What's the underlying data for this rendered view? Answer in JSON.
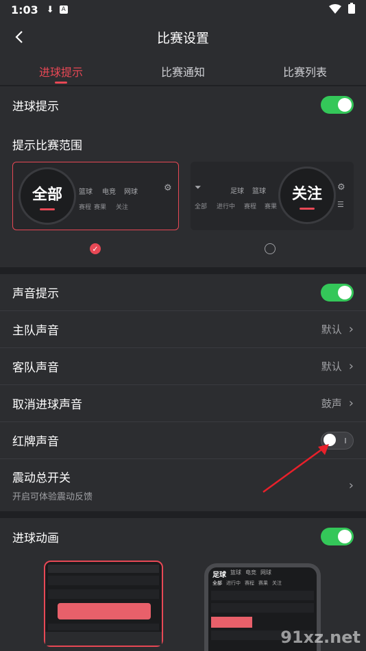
{
  "status": {
    "time": "1:03"
  },
  "header": {
    "title": "比赛设置"
  },
  "tabs": [
    {
      "label": "进球提示",
      "active": true
    },
    {
      "label": "比赛通知",
      "active": false
    },
    {
      "label": "比赛列表",
      "active": false
    }
  ],
  "goal_tip": {
    "label": "进球提示",
    "enabled": true
  },
  "range": {
    "label": "提示比赛范围",
    "option_all": {
      "circle": "全部",
      "tabs": [
        "篮球",
        "电竞",
        "网球"
      ],
      "subtabs": [
        "赛程",
        "赛果",
        "关注"
      ],
      "selected": true
    },
    "option_follow": {
      "circle": "关注",
      "tabs": [
        "足球",
        "篮球"
      ],
      "subtabs": [
        "全部",
        "进行中",
        "赛程",
        "赛果"
      ],
      "selected": false
    }
  },
  "sound": {
    "sound_tip": {
      "label": "声音提示",
      "enabled": true
    },
    "home_sound": {
      "label": "主队声音",
      "value": "默认"
    },
    "away_sound": {
      "label": "客队声音",
      "value": "默认"
    },
    "cancel_goal_sound": {
      "label": "取消进球声音",
      "value": "鼓声"
    },
    "red_card_sound": {
      "label": "红牌声音",
      "enabled": false
    },
    "vibration": {
      "label": "震动总开关",
      "sub": "开启可体验震动反馈"
    }
  },
  "animation": {
    "label": "进球动画",
    "enabled": true
  },
  "preview_right": {
    "tabs": [
      "足球",
      "篮球",
      "电竞",
      "网球"
    ],
    "subtabs": [
      "全部",
      "进行中",
      "赛程",
      "赛果",
      "关注"
    ]
  },
  "watermark": "91xz.net",
  "colors": {
    "accent": "#e84855",
    "toggle_on": "#34c759",
    "background": "#2c2d30"
  }
}
